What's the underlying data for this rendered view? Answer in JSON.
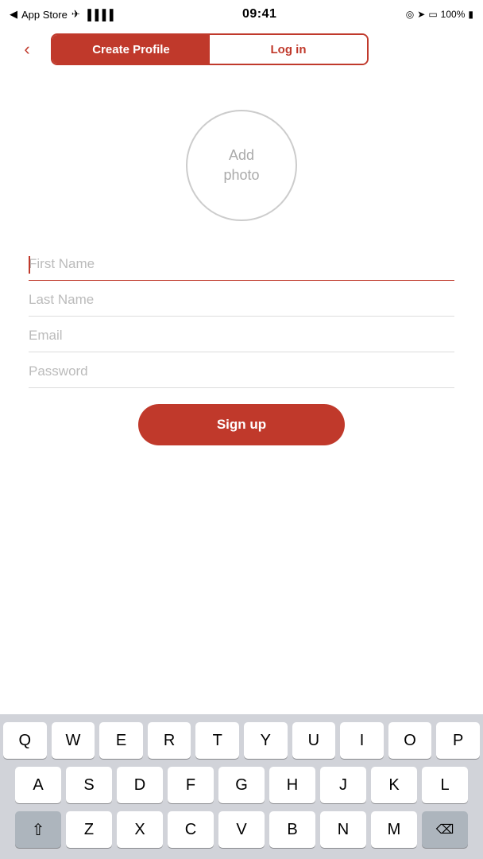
{
  "statusBar": {
    "carrier": "App Store",
    "time": "09:41",
    "battery": "100%"
  },
  "navigation": {
    "backLabel": "‹"
  },
  "tabs": {
    "createProfile": "Create Profile",
    "logIn": "Log in"
  },
  "avatar": {
    "line1": "Add",
    "line2": "photo"
  },
  "form": {
    "firstNamePlaceholder": "First Name",
    "lastNamePlaceholder": "Last Name",
    "emailPlaceholder": "Email",
    "passwordPlaceholder": "Password"
  },
  "signupButton": {
    "label": "Sign up"
  },
  "keyboard": {
    "row1": [
      "Q",
      "W",
      "E",
      "R",
      "T",
      "Y",
      "U",
      "I",
      "O",
      "P"
    ],
    "row2": [
      "A",
      "S",
      "D",
      "F",
      "G",
      "H",
      "J",
      "K",
      "L"
    ],
    "row3": [
      "Z",
      "X",
      "C",
      "V",
      "B",
      "N",
      "M"
    ]
  }
}
